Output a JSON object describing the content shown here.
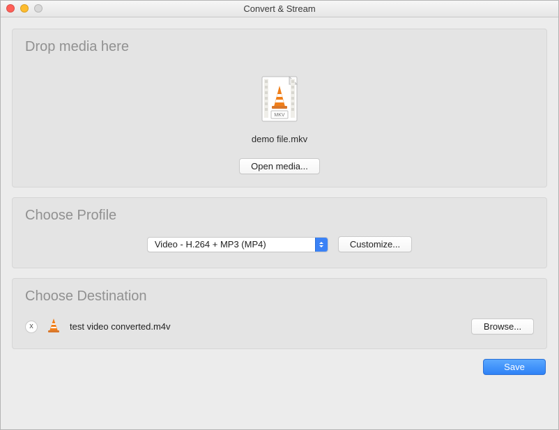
{
  "window": {
    "title": "Convert & Stream"
  },
  "drop": {
    "heading": "Drop media here",
    "file_name": "demo file.mkv",
    "file_badge": "MKV",
    "open_button": "Open media..."
  },
  "profile": {
    "heading": "Choose Profile",
    "selected": "Video - H.264 + MP3 (MP4)",
    "customize_button": "Customize..."
  },
  "destination": {
    "heading": "Choose Destination",
    "remove_label": "x",
    "output_file": "test video converted.m4v",
    "browse_button": "Browse..."
  },
  "footer": {
    "save_button": "Save"
  }
}
